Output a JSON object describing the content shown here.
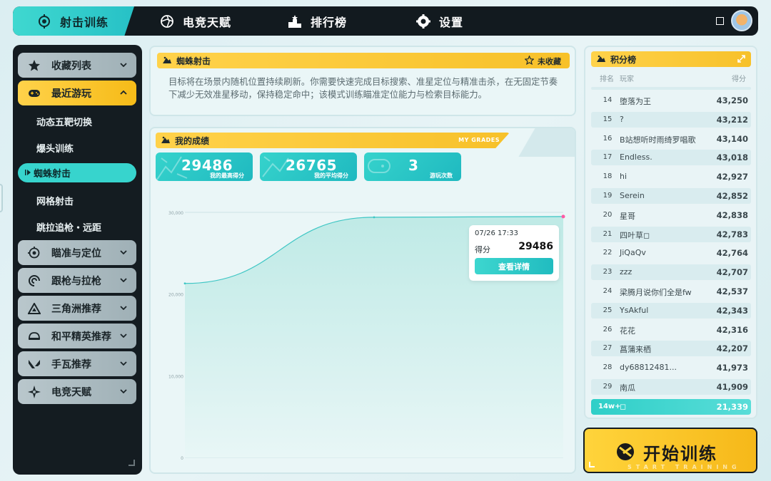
{
  "nav": {
    "items": [
      {
        "label": "射击训练",
        "icon": "crosshair-icon"
      },
      {
        "label": "电竞天赋",
        "icon": "aperture-icon"
      },
      {
        "label": "排行榜",
        "icon": "podium-icon"
      },
      {
        "label": "设置",
        "icon": "gear-icon"
      }
    ]
  },
  "sidebar": {
    "groups": [
      {
        "label": "收藏列表",
        "icon": "star-icon"
      },
      {
        "label": "最近游玩",
        "icon": "gamepad-icon"
      },
      {
        "label": "瞄准与定位",
        "icon": "target-icon"
      },
      {
        "label": "跟枪与拉枪",
        "icon": "swirl-icon"
      },
      {
        "label": "三角洲推荐",
        "icon": "delta-icon"
      },
      {
        "label": "和平精英推荐",
        "icon": "helmet-icon"
      },
      {
        "label": "手瓦推荐",
        "icon": "valorant-icon"
      },
      {
        "label": "电竞天赋",
        "icon": "sparkle-icon"
      }
    ],
    "recent": [
      "动态五靶切换",
      "爆头训练",
      "蜘蛛射击",
      "网格射击",
      "跳拉追枪・远距"
    ]
  },
  "info": {
    "title": "蜘蛛射击",
    "fav_label": "未收藏",
    "desc": "目标将在场景内随机位置持续刷新。你需要快速完成目标搜索、准星定位与精准击杀，在无固定节奏下减少无效准星移动，保持稳定命中；该模式训练瞄准定位能力与检索目标能力。"
  },
  "grades": {
    "title": "我的成绩",
    "title_en": "MY GRADES",
    "stats": [
      {
        "value": "29486",
        "label": "我的最高得分"
      },
      {
        "value": "26765",
        "label": "我的平均得分"
      },
      {
        "value": "3",
        "label": "游玩次数"
      }
    ],
    "tooltip": {
      "date": "07/26 17:33",
      "label": "得分",
      "value": "29486",
      "button": "查看详情"
    }
  },
  "chart_data": {
    "type": "area",
    "x": [
      "1",
      "2",
      "3"
    ],
    "series": [
      {
        "values": [
          21300,
          29400,
          29486
        ]
      }
    ],
    "ylim": [
      0,
      30000
    ],
    "yticks": [
      "30,000",
      "20,000",
      "10,000",
      "0"
    ],
    "grid": true,
    "colors": {
      "line": "#3dc6c4",
      "fill": "#bfeae6",
      "highlight": "#ff5aa5"
    }
  },
  "leaderboard": {
    "title": "积分榜",
    "col_rank": "排名",
    "col_player": "玩家",
    "col_score": "得分",
    "rows": [
      {
        "rank": "14",
        "name": "堕落为王",
        "score": "43,250"
      },
      {
        "rank": "15",
        "name": "?",
        "score": "43,212"
      },
      {
        "rank": "16",
        "name": "B站想听时雨绮罗唱歌",
        "score": "43,140"
      },
      {
        "rank": "17",
        "name": "Endless.",
        "score": "43,018"
      },
      {
        "rank": "18",
        "name": "hi",
        "score": "42,927"
      },
      {
        "rank": "19",
        "name": "Serein",
        "score": "42,852"
      },
      {
        "rank": "20",
        "name": "星哥",
        "score": "42,838"
      },
      {
        "rank": "21",
        "name": "四叶草◻",
        "score": "42,783"
      },
      {
        "rank": "22",
        "name": "JiQaQv",
        "score": "42,764"
      },
      {
        "rank": "23",
        "name": "zzz",
        "score": "42,707"
      },
      {
        "rank": "24",
        "name": "梁腾月说你们全是fw",
        "score": "42,537"
      },
      {
        "rank": "25",
        "name": "YsAkful",
        "score": "42,343"
      },
      {
        "rank": "26",
        "name": "花花",
        "score": "42,316"
      },
      {
        "rank": "27",
        "name": "菖蒲来栖",
        "score": "42,207"
      },
      {
        "rank": "28",
        "name": "dy68812481...",
        "score": "41,973"
      },
      {
        "rank": "29",
        "name": "南瓜",
        "score": "41,909"
      }
    ],
    "me": {
      "rank": "14w+",
      "name": "◻",
      "score": "21,339"
    }
  },
  "start": {
    "label": "开始训练",
    "sub": "START TRAINING"
  },
  "colors": {
    "accent": "#37d4cd",
    "yellow": "#f7c12a",
    "dark": "#141c21"
  }
}
